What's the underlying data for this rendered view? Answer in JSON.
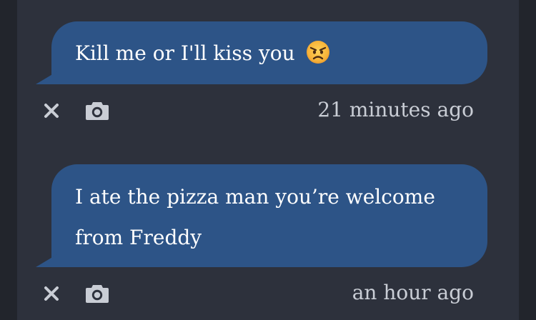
{
  "messages": [
    {
      "text": "Kill me or I'll kiss you",
      "emoji": "angry-face",
      "timestamp": "21 minutes ago"
    },
    {
      "text_line1": "I ate the pizza man you’re welcome",
      "text_line2": "from Freddy",
      "timestamp": "an hour ago"
    }
  ],
  "icons": {
    "delete": "close-icon",
    "photo": "camera-icon"
  },
  "colors": {
    "background": "#22252c",
    "panel": "#2d313c",
    "bubble": "#2d5487",
    "text": "#ffffff",
    "meta": "#c9cdd5"
  }
}
